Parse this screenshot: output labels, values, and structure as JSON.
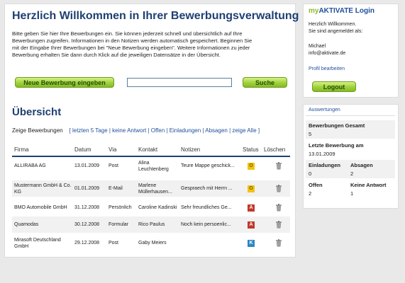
{
  "main": {
    "title": "Herzlich Willkommen in Ihrer Bewerbungsverwaltung",
    "intro_lines": [
      "Bitte geben Sie hier Ihre Bewerbungen ein. Sie können jederzeit schnell und übersichtlich auf Ihre",
      "Bewerbungen zugreifen. Informationen in den Notizen werden automatisch gespeichert. Beginnen Sie",
      "mit der Eingabe Ihrer Bewerbungen bei \"Neue Bewerbung eingeben\". Weitere Informationen zu jeder",
      "Bewerbung erhalten Sie dann durch Klick auf die jeweiligen Datensätze in der Übersicht."
    ],
    "new_button": "Neue Bewerbung eingeben",
    "search_button": "Suche",
    "search_value": ""
  },
  "overview": {
    "title": "Übersicht",
    "filter_label": "Zeige Bewerbungen",
    "filters": [
      "letzten 5 Tage",
      "keine Antwort",
      "Offen",
      "Einladungen",
      "Absagen",
      "zeige Alle"
    ],
    "columns": [
      "Firma",
      "Datum",
      "Via",
      "Kontakt",
      "Notizen",
      "Status",
      "Löschen"
    ],
    "rows": [
      {
        "firma": "ALLIRABA AG",
        "datum": "13.01.2009",
        "via": "Post",
        "kontakt": "Alina Leuchtenberg",
        "notizen": "Teure Mappe geschick...",
        "status": "O"
      },
      {
        "firma": "Mustermann GmbH & Co. KG",
        "datum": "01.01.2009",
        "via": "E-Mail",
        "kontakt": "Marlene Müllerhausen...",
        "notizen": "Gespraech mit Herrn ...",
        "status": "O"
      },
      {
        "firma": "BMO Automobile GmbH",
        "datum": "31.12.2008",
        "via": "Persönlich",
        "kontakt": "Caroline Kadinski",
        "notizen": "Sehr freundliches Ge...",
        "status": "A"
      },
      {
        "firma": "Quamodas",
        "datum": "30.12.2008",
        "via": "Formular",
        "kontakt": "Rico Paulus",
        "notizen": "Noch kein persoenlic...",
        "status": "A"
      },
      {
        "firma": "Mirasoft Deutschland GmbH",
        "datum": "29.12.2008",
        "via": "Post",
        "kontakt": "Gaby Meiers",
        "notizen": "",
        "status": "K"
      }
    ]
  },
  "login": {
    "title_prefix": "my",
    "title_rest": "AKTIVATE Login",
    "greeting": "Herzlich Willkommen.",
    "logged_in_as": "Sie sind angemeldet als:",
    "user_name": "Michael",
    "user_email": "info@aktivate.de",
    "edit_profile": "Profil bearbeiten",
    "logout": "Logout"
  },
  "stats": {
    "title": "Auswertungen",
    "total_label": "Bewerbungen Gesamt",
    "total_value": "5",
    "last_label": "Letzte Bewerbung am",
    "last_value": "13.01.2009",
    "invites_label": "Einladungen",
    "invites_value": "0",
    "rejections_label": "Absagen",
    "rejections_value": "2",
    "open_label": "Offen",
    "open_value": "2",
    "noanswer_label": "Keine Antwort",
    "noanswer_value": "1"
  },
  "colors": {
    "heading_blue": "#1f3f73",
    "link_blue": "#1f4f9a",
    "brand_green": "#8bbd23",
    "status_offen": "#f1c40f",
    "status_absage": "#c0392b",
    "status_keine": "#2e86c1"
  },
  "icons": {
    "delete": "trash-icon"
  }
}
